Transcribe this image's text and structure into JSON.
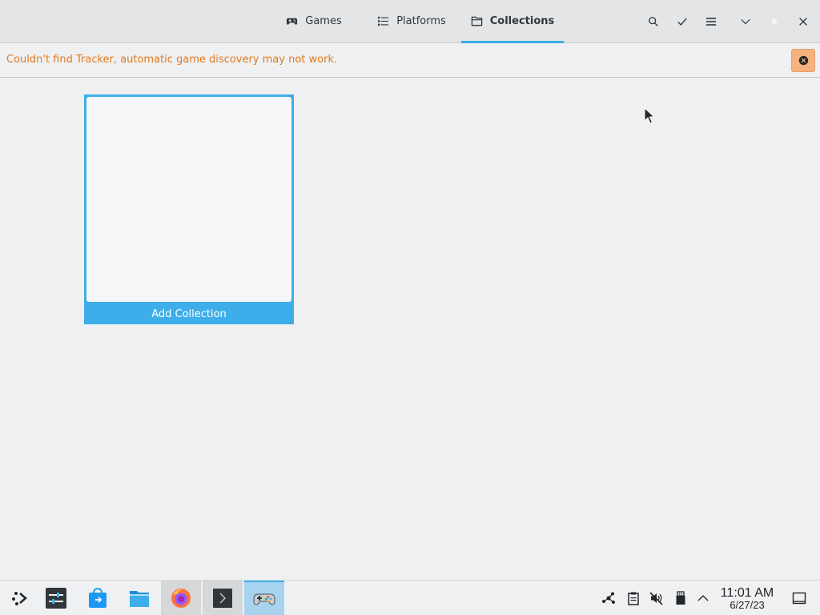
{
  "header": {
    "tabs": [
      {
        "label": "Games",
        "icon": "gamepad-icon"
      },
      {
        "label": "Platforms",
        "icon": "list-icon"
      },
      {
        "label": "Collections",
        "icon": "folder-icon",
        "active": true
      }
    ],
    "buttons": [
      "search-icon",
      "check-icon",
      "hamburger-menu-icon",
      "chevron-down-icon",
      "circle-icon",
      "close-icon"
    ]
  },
  "infobar": {
    "message": "Couldn't find Tracker, automatic game discovery may not work.",
    "close_icon": "close-circle-icon"
  },
  "collections": [
    {
      "label": "Add Collection"
    }
  ],
  "taskbar": {
    "apps": [
      "application-launcher-icon",
      "settings-icon",
      "discover-store-icon",
      "file-manager-icon",
      "firefox-icon",
      "terminal-icon",
      "games-icon"
    ],
    "tray": [
      "network-icon",
      "clipboard-icon",
      "volume-muted-icon",
      "usb-icon",
      "chevron-up-icon"
    ],
    "clock": {
      "time": "11:01 AM",
      "date": "6/27/23"
    },
    "show_desktop_icon": "show-desktop-icon"
  },
  "colors": {
    "accent": "#3daee9",
    "warning": "#e07a1f",
    "warning_button": "#f6b27e"
  }
}
